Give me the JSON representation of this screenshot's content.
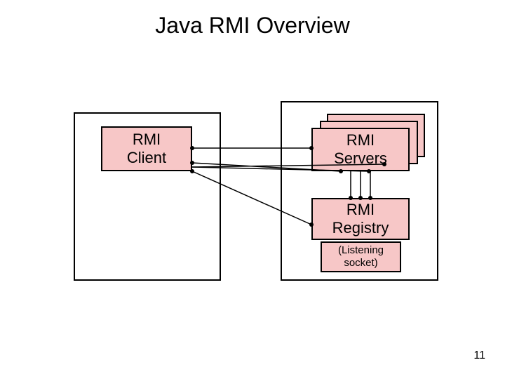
{
  "title": "Java RMI Overview",
  "client": {
    "line1": "RMI",
    "line2": "Client"
  },
  "servers": {
    "line1": "RMI",
    "line2": "Servers"
  },
  "registry": {
    "line1": "RMI",
    "line2": "Registry"
  },
  "registry_note": {
    "line1": "(Listening",
    "line2": "socket)"
  },
  "page_number": "11"
}
